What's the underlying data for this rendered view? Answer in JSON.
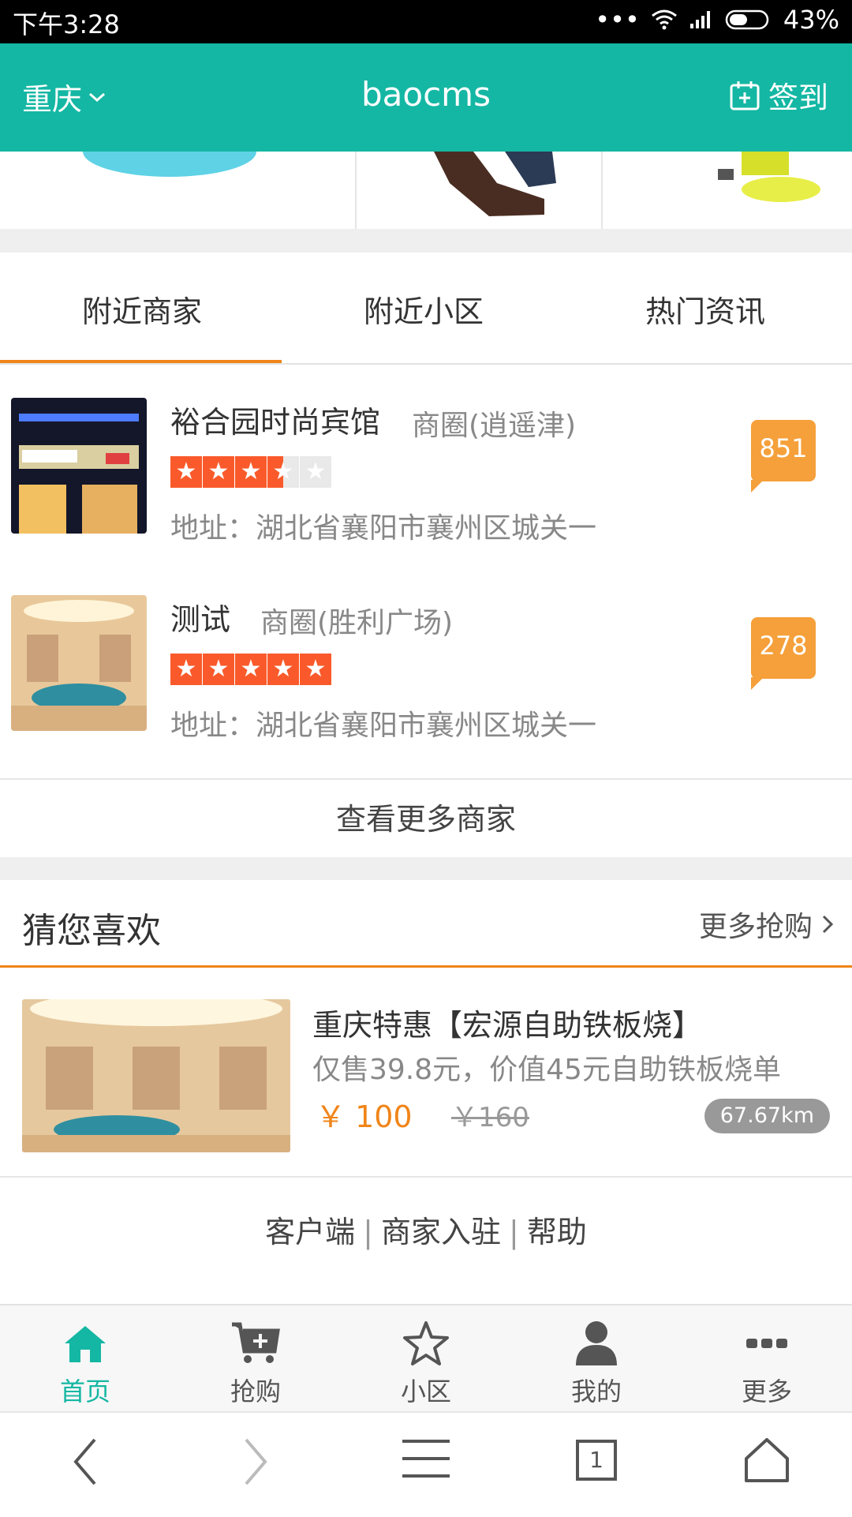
{
  "status_bar": {
    "time": "下午3:28",
    "battery": "43%"
  },
  "header": {
    "city": "重庆",
    "title": "baocms",
    "signin": "签到"
  },
  "tabs": [
    "附近商家",
    "附近小区",
    "热门资讯"
  ],
  "shops": [
    {
      "name": "裕合园时尚宾馆",
      "area": "商圈(逍遥津)",
      "rating": 3.5,
      "address": "地址：湖北省襄阳市襄州区城关一",
      "count": "851"
    },
    {
      "name": "测试",
      "area": "商圈(胜利广场)",
      "rating": 5,
      "address": "地址：湖北省襄阳市襄州区城关一",
      "count": "278"
    }
  ],
  "more_shops": "查看更多商家",
  "guess": {
    "title": "猜您喜欢",
    "more": "更多抢购"
  },
  "deal": {
    "title": "重庆特惠【宏源自助铁板烧】",
    "desc": "仅售39.8元，价值45元自助铁板烧单",
    "price": "￥ 100",
    "original_price": "￥160",
    "distance": "67.67km"
  },
  "footer_links": [
    "客户端",
    "商家入驻",
    "帮助"
  ],
  "bottom_nav": [
    {
      "label": "首页",
      "icon": "home-icon",
      "active": true
    },
    {
      "label": "抢购",
      "icon": "cart-icon",
      "active": false
    },
    {
      "label": "小区",
      "icon": "star-icon",
      "active": false
    },
    {
      "label": "我的",
      "icon": "user-icon",
      "active": false
    },
    {
      "label": "更多",
      "icon": "more-icon",
      "active": false
    }
  ],
  "browser": {
    "tab_count": "1"
  },
  "colors": {
    "brand": "#14b7a3",
    "accent": "#f08519",
    "star": "#fa5a2b",
    "bubble": "#f5a03a"
  }
}
